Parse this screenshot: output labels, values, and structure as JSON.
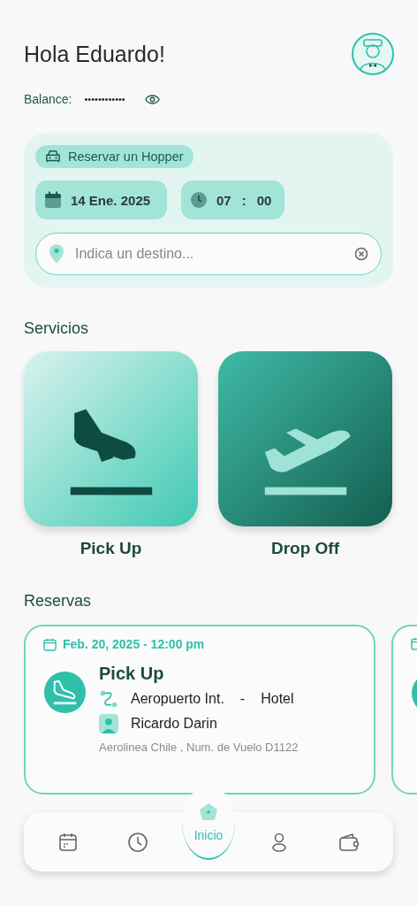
{
  "greeting": "Hola Eduardo!",
  "balance": {
    "label": "Balance:",
    "value": "••••••••••••"
  },
  "booking": {
    "title": "Reservar un Hopper",
    "date": "14 Ene. 2025",
    "hour": "07",
    "separator": ":",
    "minute": "00",
    "destination": {
      "placeholder": "Indica un destino..."
    }
  },
  "services": {
    "title": "Servicios",
    "items": [
      {
        "kind": "pickup",
        "label": "Pick Up"
      },
      {
        "kind": "dropoff",
        "label": "Drop Off"
      }
    ]
  },
  "reservations": {
    "title": "Reservas",
    "items": [
      {
        "date": "Feb. 20, 2025 - 12:00 pm",
        "kind": "pickup",
        "title": "Pick Up",
        "origin": "Aeropuerto Int.",
        "dash": "-",
        "destination": "Hotel",
        "driver": "Ricardo Darin",
        "details": "Aerolinea Chile , Num. de Vuelo D1122"
      }
    ]
  },
  "nav": [
    {
      "kind": "calendar",
      "selected": false
    },
    {
      "kind": "history",
      "selected": false
    },
    {
      "kind": "home",
      "label": "Inicio",
      "selected": true
    },
    {
      "kind": "profile",
      "selected": false
    },
    {
      "kind": "wallet",
      "selected": false
    }
  ]
}
